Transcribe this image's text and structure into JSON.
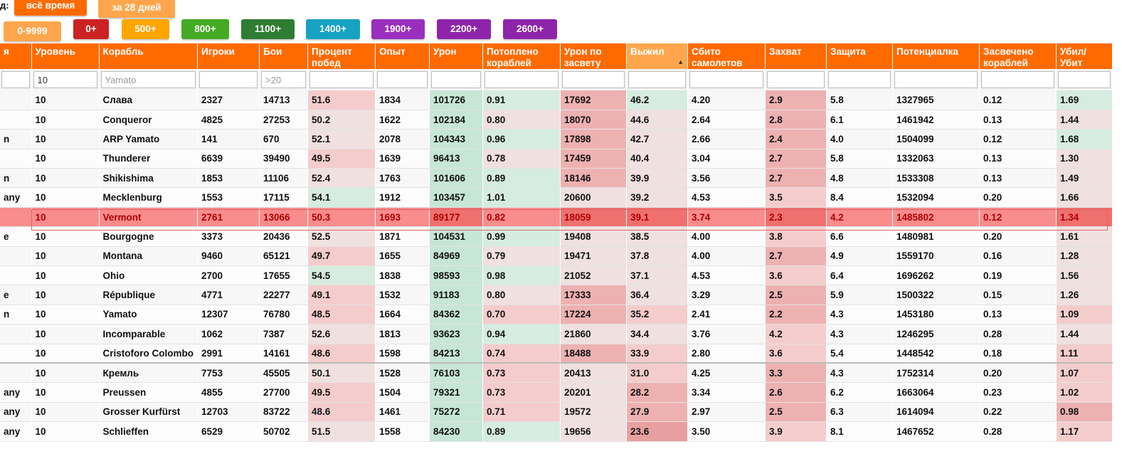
{
  "period": {
    "label": "д:",
    "buttons": [
      {
        "label": "всё время",
        "color": "#ff6a00"
      },
      {
        "label": "за 28 дней",
        "color": "#ffa64d"
      }
    ]
  },
  "rating_filters": [
    {
      "label": "0-9999",
      "color": "#ffa64d"
    },
    {
      "label": "0+",
      "color": "#cc2222"
    },
    {
      "label": "500+",
      "color": "#ffa500"
    },
    {
      "label": "800+",
      "color": "#44aa22"
    },
    {
      "label": "1100+",
      "color": "#2e7d32"
    },
    {
      "label": "1400+",
      "color": "#17a2c2"
    },
    {
      "label": "1900+",
      "color": "#9a2fbf"
    },
    {
      "label": "2200+",
      "color": "#8e24aa"
    },
    {
      "label": "2600+",
      "color": "#8e24aa"
    }
  ],
  "table": {
    "headers": [
      "я",
      "Уровень",
      "Корабль",
      "Игроки",
      "Бои",
      "Процент побед",
      "Опыт",
      "Урон",
      "Потоплено кораблей",
      "Урон по засвету",
      "Выжил",
      "Сбито самолетов",
      "Захват",
      "Защита",
      "Потенциалка",
      "Засвечено кораблей",
      "Убил/ Убит"
    ],
    "sorted_column": "Выжил",
    "filters": {
      "level": "10",
      "ship_placeholder": "Yamato",
      "battles_placeholder": ">20"
    },
    "rows": [
      [
        "",
        "10",
        "Слава",
        "2327",
        "14713",
        "51.6",
        "1834",
        "101726",
        "0.91",
        "17692",
        "46.2",
        "4.20",
        "2.9",
        "5.8",
        "1327965",
        "0.12",
        "1.69"
      ],
      [
        "",
        "10",
        "Conqueror",
        "4825",
        "27253",
        "50.2",
        "1622",
        "102184",
        "0.80",
        "18070",
        "44.6",
        "2.64",
        "2.8",
        "6.1",
        "1461942",
        "0.13",
        "1.44"
      ],
      [
        "n",
        "10",
        "ARP Yamato",
        "141",
        "670",
        "52.1",
        "2078",
        "104343",
        "0.96",
        "17898",
        "42.7",
        "2.66",
        "2.4",
        "4.0",
        "1504099",
        "0.12",
        "1.68"
      ],
      [
        "",
        "10",
        "Thunderer",
        "6639",
        "39490",
        "49.5",
        "1639",
        "96413",
        "0.78",
        "17459",
        "40.4",
        "3.04",
        "2.7",
        "5.8",
        "1332063",
        "0.13",
        "1.30"
      ],
      [
        "n",
        "10",
        "Shikishima",
        "1853",
        "11106",
        "52.4",
        "1763",
        "101606",
        "0.89",
        "18146",
        "39.9",
        "3.56",
        "2.7",
        "4.8",
        "1533308",
        "0.13",
        "1.49"
      ],
      [
        "any",
        "10",
        "Mecklenburg",
        "1553",
        "17115",
        "54.1",
        "1912",
        "103457",
        "1.01",
        "20600",
        "39.2",
        "4.53",
        "3.5",
        "8.4",
        "1532094",
        "0.20",
        "1.66"
      ],
      [
        "",
        "10",
        "Vermont",
        "2761",
        "13066",
        "50.3",
        "1693",
        "89177",
        "0.82",
        "18059",
        "39.1",
        "3.74",
        "2.3",
        "4.2",
        "1485802",
        "0.12",
        "1.34"
      ],
      [
        "e",
        "10",
        "Bourgogne",
        "3373",
        "20436",
        "52.5",
        "1871",
        "104531",
        "0.99",
        "19408",
        "38.5",
        "4.00",
        "3.8",
        "6.6",
        "1480981",
        "0.20",
        "1.61"
      ],
      [
        "",
        "10",
        "Montana",
        "9460",
        "65121",
        "49.7",
        "1655",
        "84969",
        "0.79",
        "19471",
        "37.8",
        "4.00",
        "2.7",
        "4.9",
        "1559170",
        "0.16",
        "1.28"
      ],
      [
        "",
        "10",
        "Ohio",
        "2700",
        "17655",
        "54.5",
        "1838",
        "98593",
        "0.98",
        "21052",
        "37.1",
        "4.53",
        "3.6",
        "6.4",
        "1696262",
        "0.19",
        "1.56"
      ],
      [
        "e",
        "10",
        "République",
        "4771",
        "22277",
        "49.1",
        "1532",
        "91183",
        "0.80",
        "17333",
        "36.4",
        "3.29",
        "2.5",
        "5.9",
        "1500322",
        "0.15",
        "1.26"
      ],
      [
        "n",
        "10",
        "Yamato",
        "12307",
        "76780",
        "48.5",
        "1664",
        "84362",
        "0.70",
        "17224",
        "35.2",
        "2.41",
        "2.2",
        "4.3",
        "1453180",
        "0.13",
        "1.09"
      ],
      [
        "",
        "10",
        "Incomparable",
        "1062",
        "7387",
        "52.6",
        "1813",
        "93623",
        "0.94",
        "21860",
        "34.4",
        "3.76",
        "4.2",
        "4.3",
        "1246295",
        "0.28",
        "1.44"
      ],
      [
        "",
        "10",
        "Cristoforo Colombo",
        "2991",
        "14161",
        "48.6",
        "1598",
        "84213",
        "0.74",
        "18488",
        "33.9",
        "2.80",
        "3.6",
        "5.4",
        "1448542",
        "0.18",
        "1.11"
      ],
      [
        "",
        "10",
        "Кремль",
        "7753",
        "45505",
        "50.1",
        "1528",
        "76103",
        "0.73",
        "20413",
        "31.0",
        "4.25",
        "3.3",
        "4.3",
        "1752314",
        "0.20",
        "1.07"
      ],
      [
        "any",
        "10",
        "Preussen",
        "4855",
        "27700",
        "49.5",
        "1504",
        "79321",
        "0.73",
        "20201",
        "28.2",
        "3.34",
        "2.6",
        "6.2",
        "1663064",
        "0.23",
        "1.02"
      ],
      [
        "any",
        "10",
        "Grosser Kurfürst",
        "12703",
        "83722",
        "48.6",
        "1461",
        "75272",
        "0.71",
        "19572",
        "27.9",
        "2.97",
        "2.5",
        "6.3",
        "1614094",
        "0.22",
        "0.98"
      ],
      [
        "any",
        "10",
        "Schlieffen",
        "6529",
        "50702",
        "51.5",
        "1558",
        "84230",
        "0.89",
        "19656",
        "23.6",
        "3.50",
        "3.9",
        "8.1",
        "1467652",
        "0.28",
        "1.17"
      ]
    ],
    "highlighted_row": "Vermont",
    "colors": {
      "header": "#ff6a00",
      "header_sorted": "#ffa64d",
      "highlight": "#f98c8c",
      "good": "#c7e6d6",
      "bad": "#e89f9f"
    }
  }
}
